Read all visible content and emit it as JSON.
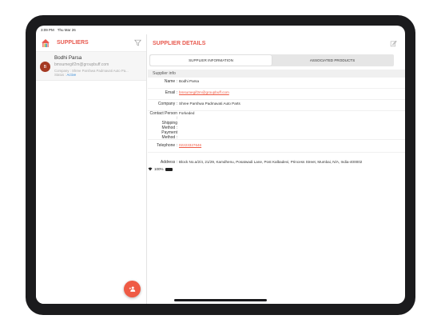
{
  "status_bar": {
    "time": "3:09 PM",
    "date": "Thu Mar 26",
    "battery_percent": "100%"
  },
  "left_pane": {
    "title": "SUPPLIERS",
    "suppliers": [
      {
        "initial": "B",
        "name": "Bodhi Parsa",
        "email": "bmsumegif2m@groupbuff.com",
        "company": "Company : Shree Parshwa Padmavati Auto Pa...",
        "status_label": "Status :",
        "status_value": "Active"
      }
    ]
  },
  "right_pane": {
    "title": "SUPPLIER DETAILS",
    "tabs": [
      {
        "label": "SUPPLIER INFORMATION",
        "selected": true
      },
      {
        "label": "ASSOCIATED PRODUCTS",
        "selected": false
      }
    ],
    "section_title": "Supplier info",
    "fields": [
      {
        "label": "Name :",
        "value": "Bodhi Parsa",
        "link": false
      },
      {
        "label": "Email :",
        "value": "bmsumegif2m@groupbuff.com",
        "link": true
      },
      {
        "label": "Company :",
        "value": "Shree Parshwa Padmavati Auto Parts",
        "link": false
      },
      {
        "label": "Contact Person :",
        "value": "Forkeded",
        "link": false
      },
      {
        "label": "Shipping Method :",
        "value": "",
        "link": false
      },
      {
        "label": "Payment Method :",
        "value": "",
        "link": false
      },
      {
        "label": "Telephone :",
        "value": "02223327646",
        "link": true
      },
      {
        "label": "Address :",
        "value": "Block No.a/2/4, 21/29, Kamdhenu, Posatwadi Lane, Post Kalbadevi, Princess Street, Mumbai, N/A, India-400002",
        "link": false
      }
    ]
  },
  "colors": {
    "accent": "#e85a4f",
    "fab": "#ef5b45",
    "avatar": "#a53a23",
    "status_active": "#3c8dd9"
  },
  "icons": {
    "home": "home-icon",
    "filter": "filter-icon",
    "edit": "edit-icon",
    "add_supplier": "add-user-icon"
  }
}
